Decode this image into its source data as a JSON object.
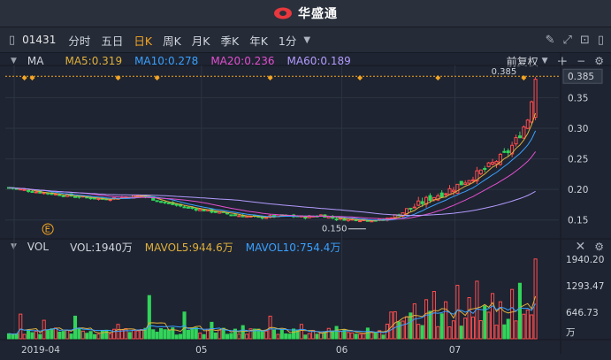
{
  "app": {
    "brand": "华盛通"
  },
  "toolbar": {
    "stock_code": "01431",
    "periods": [
      {
        "label": "分时",
        "active": false
      },
      {
        "label": "五日",
        "active": false
      },
      {
        "label": "日K",
        "active": true
      },
      {
        "label": "周K",
        "active": false
      },
      {
        "label": "月K",
        "active": false
      },
      {
        "label": "季K",
        "active": false
      },
      {
        "label": "年K",
        "active": false
      },
      {
        "label": "1分",
        "active": false
      }
    ]
  },
  "main_pane": {
    "name": "MA",
    "adjust_label": "前复权",
    "indicators": [
      {
        "label": "MA5:0.319",
        "color": "#e0b03c"
      },
      {
        "label": "MA10:0.278",
        "color": "#3aa0ff"
      },
      {
        "label": "MA20:0.236",
        "color": "#e24fd0"
      },
      {
        "label": "MA60:0.189",
        "color": "#b39bff"
      }
    ]
  },
  "vol_pane": {
    "name": "VOL",
    "indicators": [
      {
        "label": "VOL:1940万",
        "color": "#d0d4dc"
      },
      {
        "label": "MAVOL5:944.6万",
        "color": "#e0b03c"
      },
      {
        "label": "MAVOL10:754.4万",
        "color": "#3aa0ff"
      }
    ],
    "unit": "万"
  },
  "colors": {
    "up": "#ff4d4f",
    "down": "#32d45a",
    "bg": "#1e2431",
    "grid": "#2c3342"
  },
  "chart_data": {
    "type": "candlestick",
    "price_axis": {
      "ticks": [
        0.385,
        0.35,
        0.3,
        0.25,
        0.2,
        0.15
      ],
      "ylim": [
        0.125,
        0.394
      ]
    },
    "volume_axis": {
      "ticks": [
        "1940.20",
        "1293.47",
        "646.73"
      ],
      "ylim": [
        0,
        2000
      ]
    },
    "x_labels": [
      "2019-04",
      "05",
      "06",
      "07"
    ],
    "annotations": {
      "high": "0.385",
      "low": "0.150",
      "event_marker": "E"
    },
    "price_anchors": [
      [
        0,
        0.203
      ],
      [
        6,
        0.197
      ],
      [
        12,
        0.192
      ],
      [
        18,
        0.188
      ],
      [
        24,
        0.184
      ],
      [
        30,
        0.188
      ],
      [
        34,
        0.19
      ],
      [
        40,
        0.178
      ],
      [
        46,
        0.17
      ],
      [
        52,
        0.164
      ],
      [
        58,
        0.158
      ],
      [
        64,
        0.154
      ],
      [
        70,
        0.157
      ],
      [
        76,
        0.155
      ],
      [
        80,
        0.158
      ],
      [
        84,
        0.152
      ],
      [
        88,
        0.151
      ],
      [
        92,
        0.15
      ],
      [
        96,
        0.15
      ],
      [
        100,
        0.16
      ],
      [
        104,
        0.172
      ],
      [
        108,
        0.186
      ],
      [
        112,
        0.196
      ],
      [
        116,
        0.21
      ],
      [
        120,
        0.225
      ],
      [
        124,
        0.242
      ],
      [
        128,
        0.262
      ],
      [
        131,
        0.29
      ],
      [
        133,
        0.315
      ],
      [
        135,
        0.38
      ]
    ],
    "volume_spikes": [
      [
        3,
        600
      ],
      [
        9,
        450
      ],
      [
        17,
        550
      ],
      [
        28,
        350
      ],
      [
        36,
        1050
      ],
      [
        45,
        650
      ],
      [
        52,
        400
      ],
      [
        60,
        320
      ],
      [
        67,
        550
      ],
      [
        75,
        350
      ],
      [
        84,
        300
      ],
      [
        92,
        260
      ],
      [
        98,
        650
      ],
      [
        104,
        850
      ],
      [
        107,
        950
      ],
      [
        109,
        1150
      ],
      [
        112,
        900
      ],
      [
        115,
        1300
      ],
      [
        118,
        1000
      ],
      [
        120,
        1400
      ],
      [
        122,
        800
      ],
      [
        124,
        1100
      ],
      [
        126,
        900
      ],
      [
        129,
        1200
      ],
      [
        131,
        1350
      ],
      [
        133,
        700
      ],
      [
        135,
        1940
      ]
    ],
    "ma_lines": [
      {
        "name": "MA5",
        "color": "#e0b03c",
        "period": 5
      },
      {
        "name": "MA10",
        "color": "#3aa0ff",
        "period": 10
      },
      {
        "name": "MA20",
        "color": "#e24fd0",
        "period": 20
      },
      {
        "name": "MA60",
        "color": "#b39bff",
        "period": 60
      }
    ]
  }
}
